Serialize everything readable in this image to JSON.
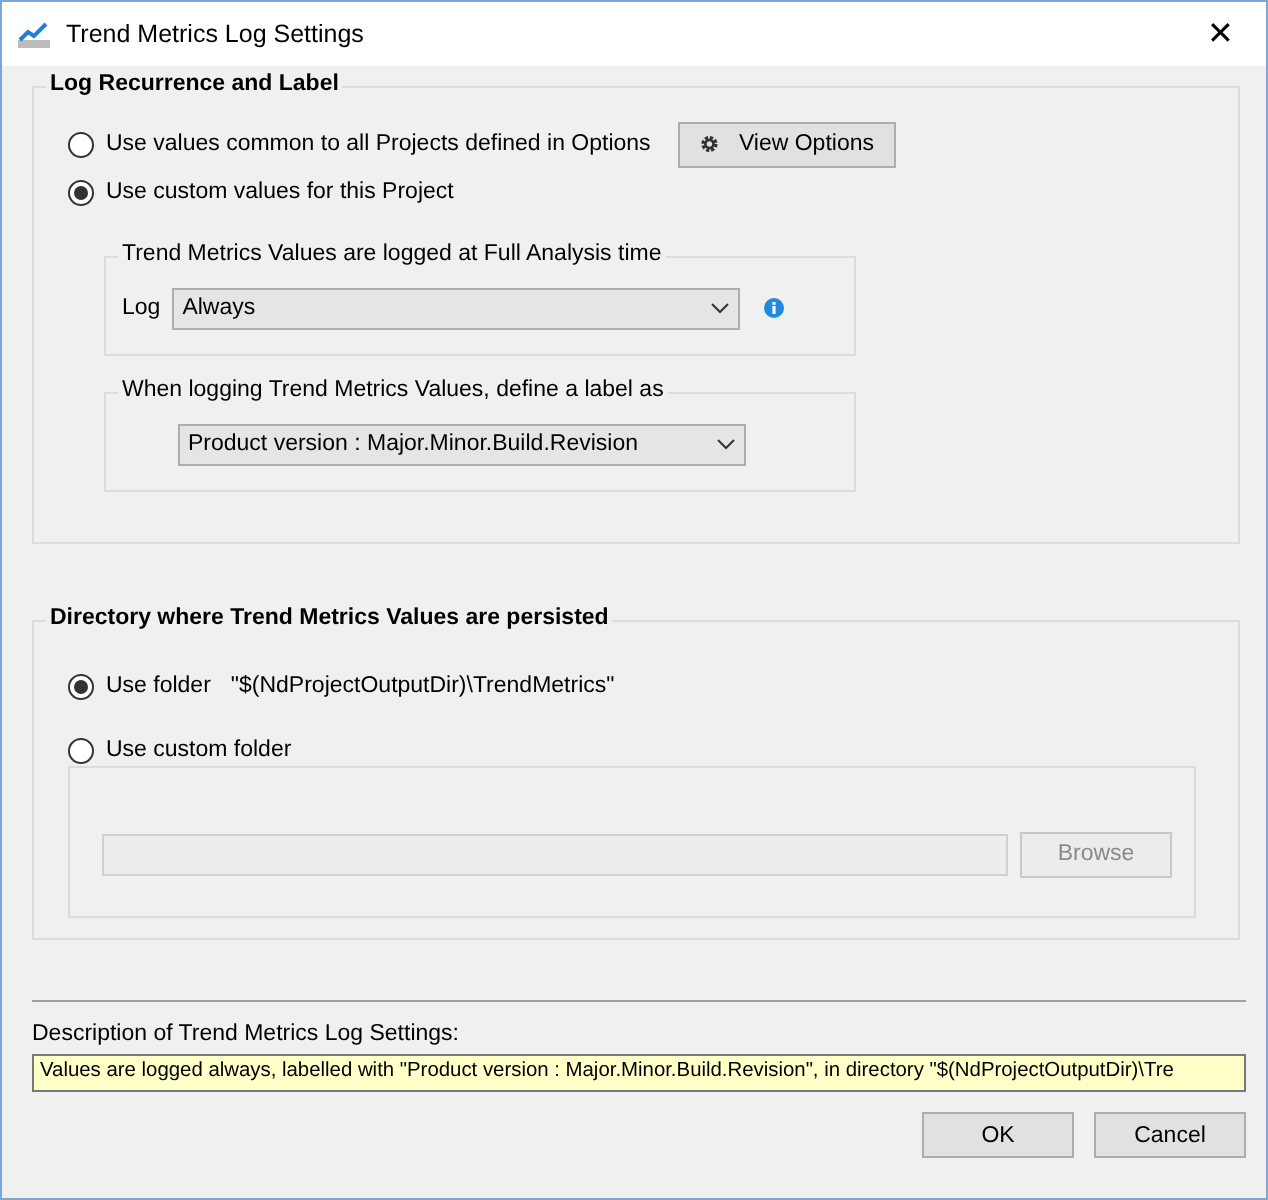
{
  "window": {
    "title": "Trend Metrics Log Settings",
    "close": "✕"
  },
  "recurrence": {
    "title": "Log Recurrence and Label",
    "options": [
      {
        "label": "Use values common to all Projects defined in Options",
        "selected": false
      },
      {
        "label": "Use custom values for this Project",
        "selected": true
      }
    ],
    "view_options": "View Options",
    "log_group": {
      "title": "Trend Metrics Values are logged at Full Analysis time",
      "label": "Log",
      "value": "Always"
    },
    "label_group": {
      "title": "When logging Trend Metrics Values, define a label as",
      "value": "Product version : Major.Minor.Build.Revision"
    }
  },
  "directory": {
    "title": "Directory where Trend Metrics Values are persisted",
    "options": [
      {
        "label": "Use folder",
        "path": "\"$(NdProjectOutputDir)\\TrendMetrics\"",
        "selected": true
      },
      {
        "label": "Use custom folder",
        "selected": false
      }
    ],
    "browse": {
      "label": "Browse",
      "disabled": true
    }
  },
  "description": {
    "label": "Description of Trend Metrics Log Settings:",
    "value": "Values are logged always, labelled with \"Product version : Major.Minor.Build.Revision\", in directory \"$(NdProjectOutputDir)\\Tre"
  },
  "buttons": [
    "OK",
    "Cancel"
  ]
}
